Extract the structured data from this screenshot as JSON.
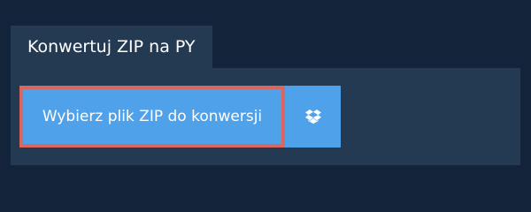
{
  "tab": {
    "label": "Konwertuj ZIP na PY"
  },
  "actions": {
    "choose_file_label": "Wybierz plik ZIP do konwersji",
    "dropbox_icon": "dropbox-icon"
  },
  "colors": {
    "background": "#13233a",
    "panel": "#243a52",
    "button": "#4fa1ea",
    "focus_border": "#d9665f",
    "text": "#ffffff"
  }
}
